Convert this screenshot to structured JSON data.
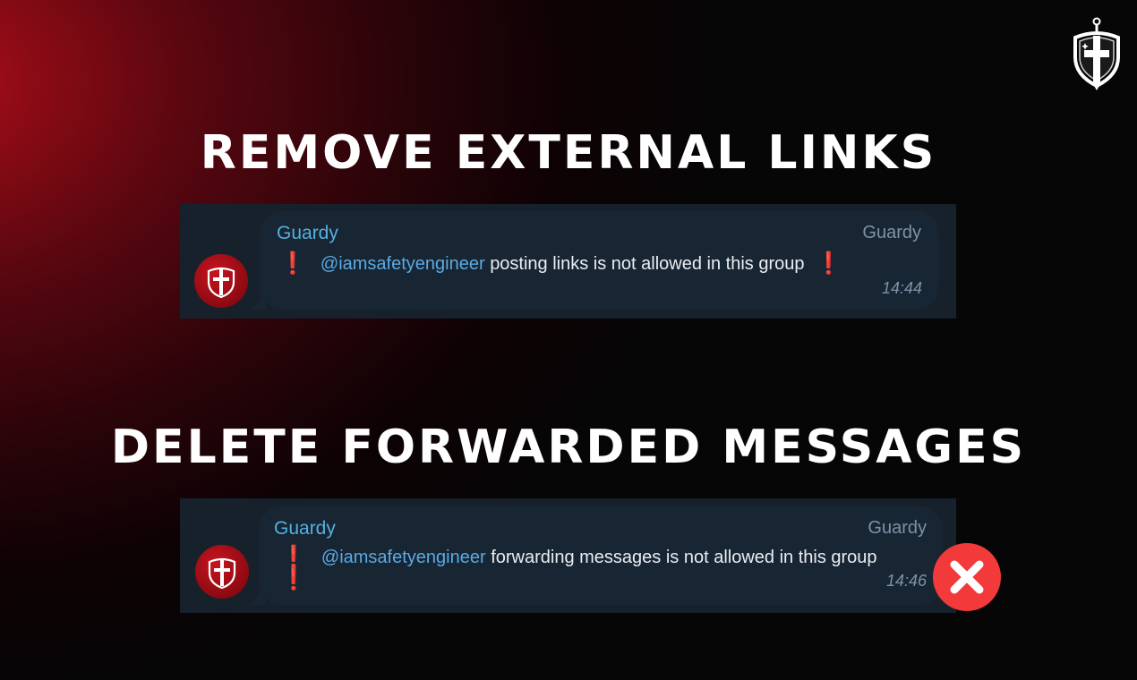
{
  "brand": {
    "logo_icon": "shield-sword-logo-icon",
    "accent_color": "#b5101b"
  },
  "sections": [
    {
      "heading": "REMOVE EXTERNAL LINKS",
      "message": {
        "avatar_icon": "shield-avatar-icon",
        "sender": "Guardy",
        "tag": "Guardy",
        "mention": "@iamsafetyengineer",
        "text": "posting links is not allowed in this group",
        "lead_icon": "❗",
        "trail_icon": "❗",
        "time": "14:44"
      }
    },
    {
      "heading": "DELETE FORWARDED MESSAGES",
      "message": {
        "avatar_icon": "shield-avatar-icon",
        "sender": "Guardy",
        "tag": "Guardy",
        "mention": "@iamsafetyengineer",
        "text": "forwarding messages is not allowed in this group",
        "lead_icon": "❗",
        "trail_icon": "❗",
        "time": "14:46"
      },
      "status_icon": "cross-mark-icon"
    }
  ]
}
